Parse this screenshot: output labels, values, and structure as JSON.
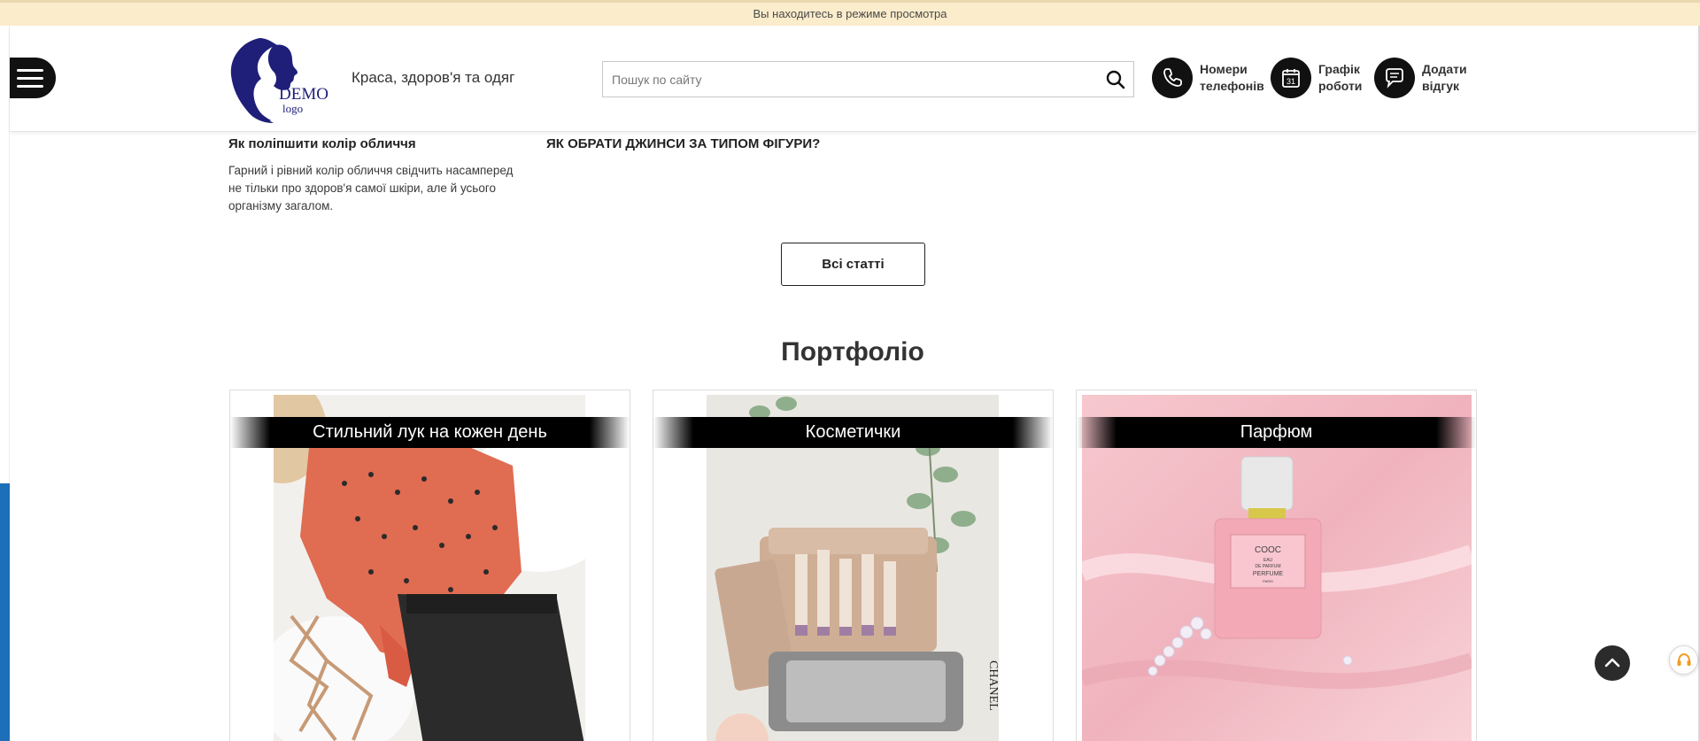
{
  "preview_bar": {
    "text": "Вы находитесь в режиме просмотра"
  },
  "header": {
    "menu_icon": "hamburger-menu-icon",
    "logo": {
      "main": "DEMO",
      "sub": "logo",
      "color": "#1f1f7a"
    },
    "tagline": "Краса, здоров'я та одяг",
    "search": {
      "placeholder": "Пошук по сайту",
      "value": "",
      "icon": "search-icon"
    },
    "contacts": [
      {
        "icon": "phone-icon",
        "line1": "Номери",
        "line2": "телефонів"
      },
      {
        "icon": "calendar-icon",
        "line1": "Графік",
        "line2": "роботи",
        "calendar_day": "31"
      },
      {
        "icon": "chat-icon",
        "line1": "Додати",
        "line2": "відгук"
      }
    ]
  },
  "articles": [
    {
      "title": "Як поліпшити колір обличчя",
      "text": "Гарний і рівний колір обличчя свідчить насамперед не тільки про здоров'я самої шкіри, але й усього організму загалом."
    },
    {
      "title": "ЯК ОБРАТИ ДЖИНСИ ЗА ТИПОМ ФІГУРИ?",
      "text": ""
    }
  ],
  "all_articles_button": "Всі статті",
  "portfolio": {
    "title": "Портфоліо",
    "items": [
      {
        "label": "Стильний лук на кожен день"
      },
      {
        "label": "Косметички",
        "sign": "CHANEL"
      },
      {
        "label": "Парфюм",
        "bottle": {
          "brand": "COOC",
          "line1": "EAU",
          "line2": "DE PARFUM",
          "line3": "PERFUME",
          "line4": "PARIS"
        }
      }
    ]
  },
  "floating": {
    "scroll_top_icon": "chevron-up-icon",
    "support_icon": "headset-icon"
  },
  "colors": {
    "preview_bg": "#fbeccb",
    "accent_blue": "#1c6fb8",
    "dark": "#111111"
  }
}
